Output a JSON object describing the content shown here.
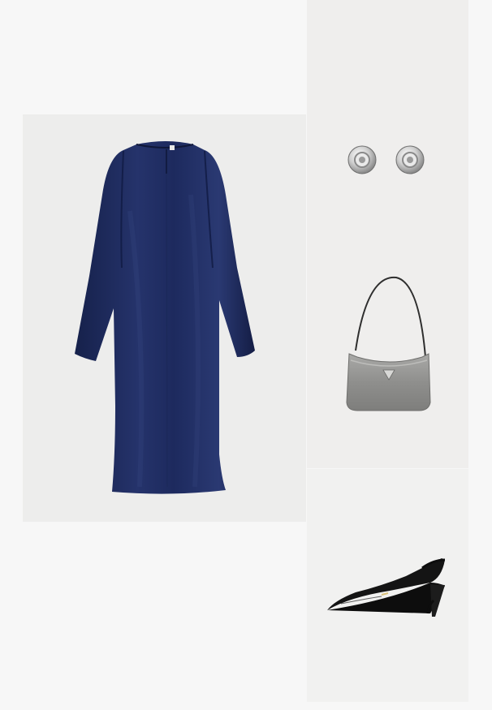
{
  "outfit": {
    "items": [
      {
        "id": "dress",
        "icon": "long-sleeve-dress-icon",
        "color": "#1c2a5c"
      },
      {
        "id": "earrings",
        "icon": "stud-earrings-icon",
        "color": "#c9c9c9"
      },
      {
        "id": "handbag",
        "icon": "shoulder-bag-icon",
        "color": "#9a9a98"
      },
      {
        "id": "shoes",
        "icon": "slingback-pump-icon",
        "color": "#121212"
      }
    ]
  }
}
